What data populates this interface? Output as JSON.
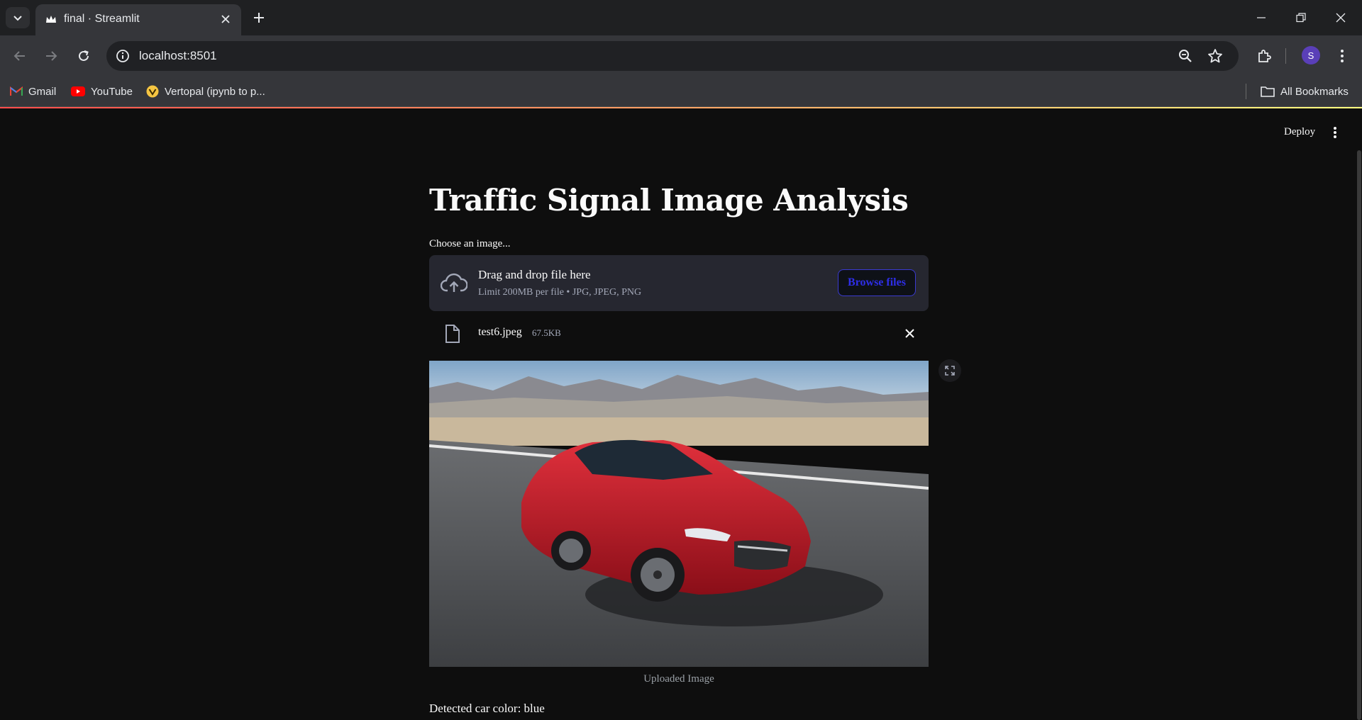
{
  "browser": {
    "tab_title": "final · Streamlit",
    "url": "localhost:8501",
    "bookmarks": [
      "Gmail",
      "YouTube",
      "Vertopal (ipynb to p..."
    ],
    "all_bookmarks": "All Bookmarks",
    "profile_initial": "S"
  },
  "header": {
    "deploy_label": "Deploy"
  },
  "page": {
    "title": "Traffic Signal Image Analysis",
    "uploader_label": "Choose an image...",
    "dropzone_title": "Drag and drop file here",
    "dropzone_limit": "Limit 200MB per file • JPG, JPEG, PNG",
    "browse_label": "Browse files",
    "file": {
      "name": "test6.jpeg",
      "size": "67.5KB"
    },
    "image_caption": "Uploaded Image",
    "result_text": "Detected car color: blue"
  },
  "colors": {
    "accent": "#ff4b4b",
    "browse_text": "#2e2ee8",
    "dropzone_bg": "#262730",
    "page_bg": "#0e0e0e"
  }
}
